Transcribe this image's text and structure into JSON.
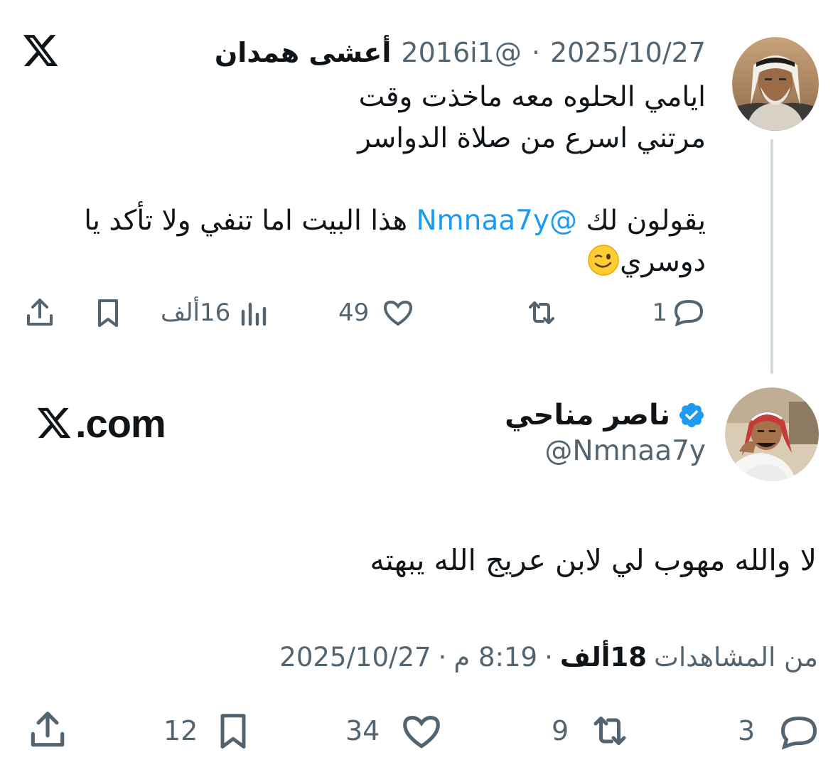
{
  "parent_tweet": {
    "author_name": "أعشى همدان",
    "author_handle": "@2016i1",
    "date": "2025/10/27",
    "separator": "·",
    "lines": [
      "ايامي الحلوه معه ماخذت وقت",
      "مرتني اسرع من صلاة الدواسر"
    ],
    "line3_before_mention": "يقولون لك ",
    "mention": "@Nmnaa7y",
    "line3_after_mention": " هذا البيت اما تنفي ولا تأكد يا",
    "line4": "دوسري",
    "emoji": "winking-face",
    "reply_count": "1",
    "like_count": "49",
    "views_count": "16ألف"
  },
  "main_tweet": {
    "author_name": "ناصر مناحي",
    "author_handle": "@Nmnaa7y",
    "verified": true,
    "text": "لا والله مهوب لي لابن عريج  الله يبهته",
    "date": "2025/10/27",
    "time": "8:19 م",
    "views_count": "18ألف",
    "views_label": "من المشاهدات",
    "separator": "·",
    "reply_count": "3",
    "retweet_count": "9",
    "like_count": "34",
    "bookmark_count": "12"
  },
  "branding": {
    "logo_text": ".com",
    "logo_icon": "x-logo-icon"
  },
  "colors": {
    "text_primary": "#0f1419",
    "text_secondary": "#536471",
    "link": "#1d9bf0",
    "verified": "#1d9bf0",
    "thread_line": "#cfd9de"
  }
}
